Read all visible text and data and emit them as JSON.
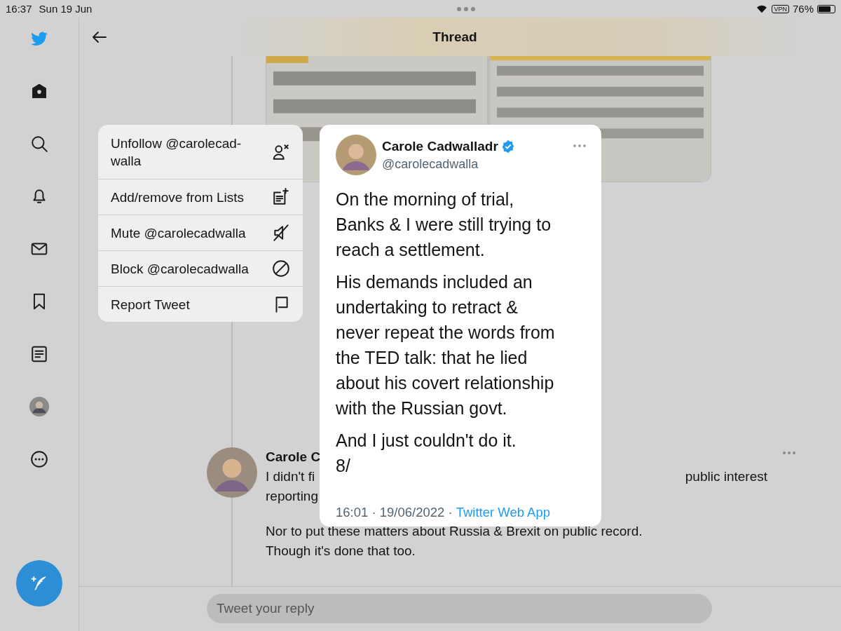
{
  "status_bar": {
    "time": "16:37",
    "date": "Sun 19 Jun",
    "vpn": "VPN",
    "battery": "76%"
  },
  "sidebar": {
    "items": [
      {
        "kind": "home",
        "selected": true
      },
      {
        "kind": "search",
        "selected": false
      },
      {
        "kind": "bell",
        "selected": false
      },
      {
        "kind": "mail",
        "selected": false
      },
      {
        "kind": "bookmark",
        "selected": false
      },
      {
        "kind": "lists",
        "selected": false
      },
      {
        "kind": "avatar",
        "selected": false
      },
      {
        "kind": "more",
        "selected": false
      }
    ]
  },
  "header": {
    "title": "Thread"
  },
  "background_tweet": {
    "name": "Carole C",
    "line_1_left": "I didn't fi",
    "line_1_right": "public interest",
    "line_2": "reporting",
    "paragraph": [
      "Nor to put these matters about Russia & Brexit on public record.",
      "Though it's done that too."
    ]
  },
  "context_menu": {
    "items": [
      {
        "label": "Unfollow @carolecad-\nwalla"
      },
      {
        "label": "Add/remove from Lists"
      },
      {
        "label": "Mute @carolecadwalla"
      },
      {
        "label": "Block @carolecadwalla"
      },
      {
        "label": "Report Tweet"
      }
    ]
  },
  "tweet_preview": {
    "name": "Carole Cadwalladr",
    "verified": true,
    "handle": "@carolecadwalla",
    "paragraphs": [
      "On the morning of trial,\nBanks & I were still trying to\nreach a settlement.",
      "His demands included an\nundertaking to retract &\nnever repeat the words from\nthe TED talk: that he lied\nabout his covert relationship\nwith the Russian govt.",
      "And I just couldn't do it.\n8/"
    ],
    "meta": "16:01 · 19/06/2022 ·",
    "source": "Twitter Web App"
  },
  "reply": {
    "placeholder": "Tweet your reply"
  }
}
